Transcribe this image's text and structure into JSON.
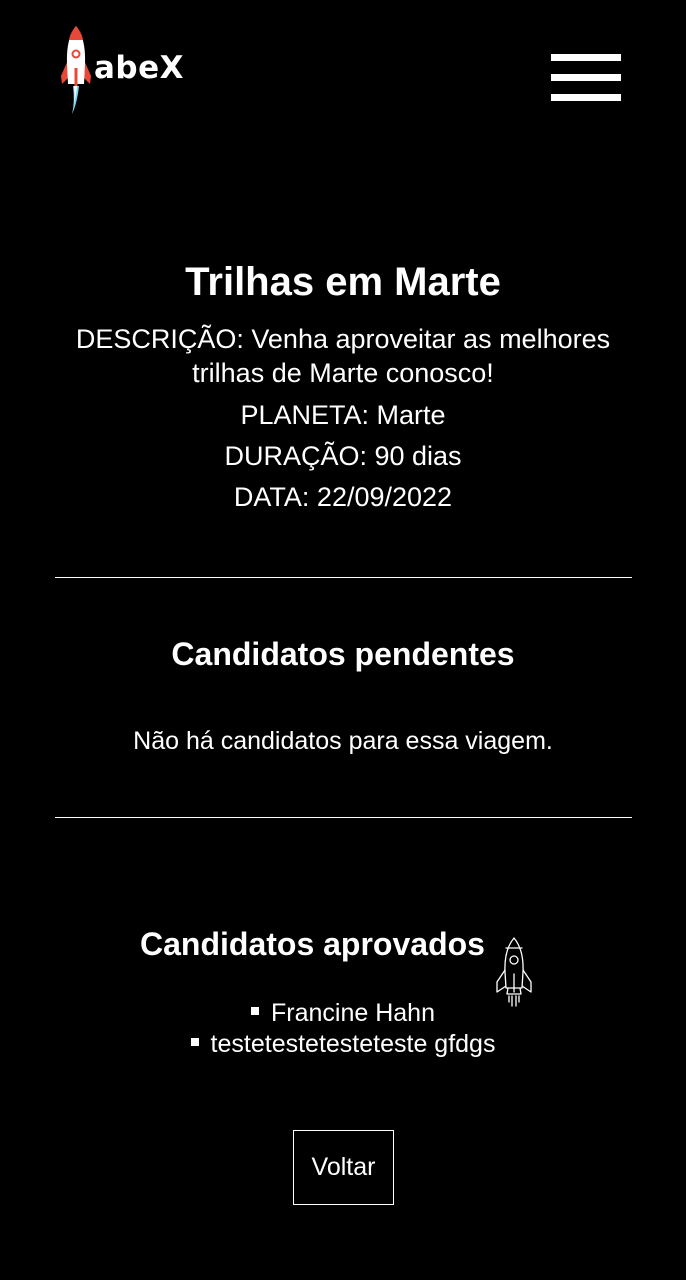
{
  "header": {
    "logo_text": "abeX",
    "logo_icon": "rocket-icon",
    "menu_icon": "hamburger-menu-icon"
  },
  "trip": {
    "title": "Trilhas em Marte",
    "description": "DESCRIÇÃO: Venha aproveitar as melhores trilhas de Marte conosco!",
    "planet": "PLANETA: Marte",
    "duration": "DURAÇÃO: 90 dias",
    "date": "DATA: 22/09/2022"
  },
  "pending": {
    "title": "Candidatos pendentes",
    "empty_message": "Não há candidatos para essa viagem."
  },
  "approved": {
    "title": "Candidatos aprovados",
    "icon": "rocket-outline-icon",
    "candidates": [
      "Francine Hahn",
      "testetestetesteteste gfdgs"
    ]
  },
  "actions": {
    "back_label": "Voltar"
  },
  "colors": {
    "background": "#000000",
    "text": "#ffffff",
    "rocket_red": "#e8483a",
    "rocket_flame": "#7fd3f2"
  }
}
